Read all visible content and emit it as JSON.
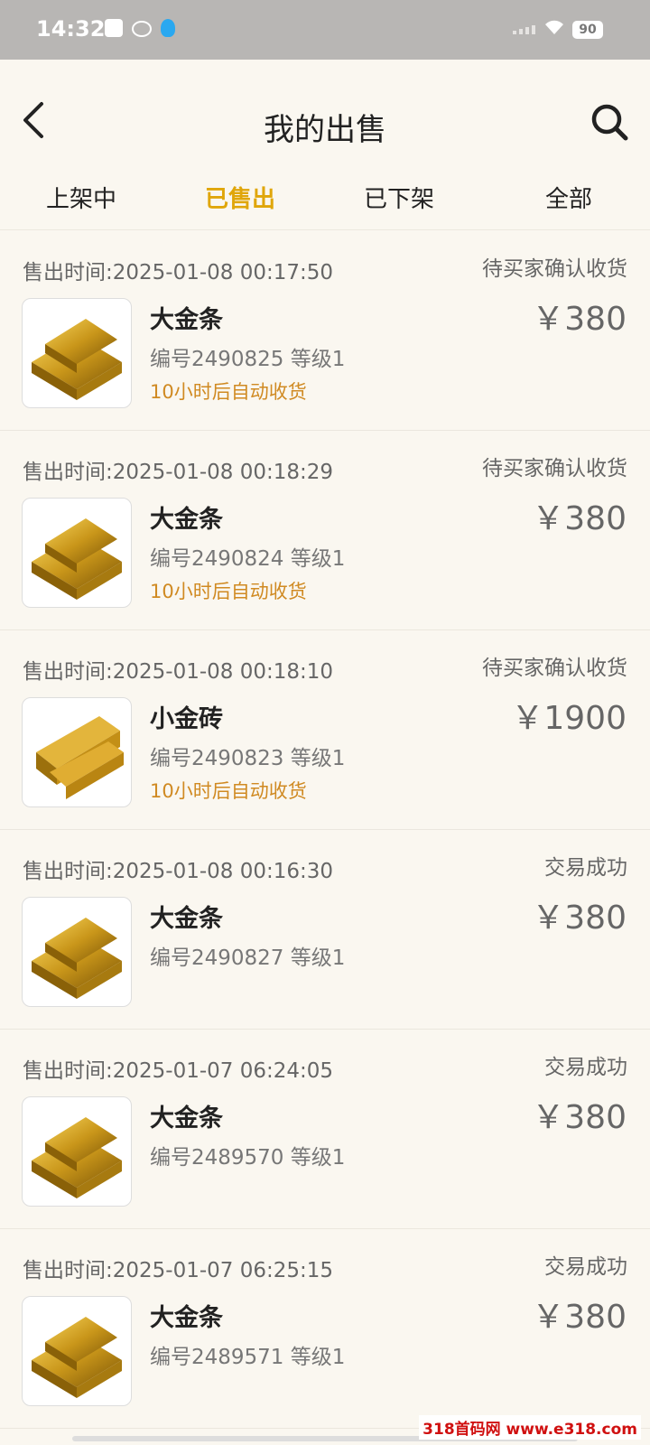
{
  "status_bar": {
    "time": "14:32",
    "battery": "90"
  },
  "header": {
    "title": "我的出售"
  },
  "tabs": [
    {
      "label": "上架中",
      "active": false
    },
    {
      "label": "已售出",
      "active": true
    },
    {
      "label": "已下架",
      "active": false
    },
    {
      "label": "全部",
      "active": false
    }
  ],
  "orders": [
    {
      "time": "售出时间:2025-01-08 00:17:50",
      "status": "待买家确认收货",
      "name": "大金条",
      "info": "编号2490825 等级1",
      "note": "10小时后自动收货",
      "price": "￥380",
      "item_type": "gold-bars-icon"
    },
    {
      "time": "售出时间:2025-01-08 00:18:29",
      "status": "待买家确认收货",
      "name": "大金条",
      "info": "编号2490824 等级1",
      "note": "10小时后自动收货",
      "price": "￥380",
      "item_type": "gold-bars-icon"
    },
    {
      "time": "售出时间:2025-01-08 00:18:10",
      "status": "待买家确认收货",
      "name": "小金砖",
      "info": "编号2490823 等级1",
      "note": "10小时后自动收货",
      "price": "￥1900",
      "item_type": "gold-bricks-icon"
    },
    {
      "time": "售出时间:2025-01-08 00:16:30",
      "status": "交易成功",
      "name": "大金条",
      "info": "编号2490827 等级1",
      "note": "",
      "price": "￥380",
      "item_type": "gold-bars-icon"
    },
    {
      "time": "售出时间:2025-01-07 06:24:05",
      "status": "交易成功",
      "name": "大金条",
      "info": "编号2489570 等级1",
      "note": "",
      "price": "￥380",
      "item_type": "gold-bars-icon"
    },
    {
      "time": "售出时间:2025-01-07 06:25:15",
      "status": "交易成功",
      "name": "大金条",
      "info": "编号2489571 等级1",
      "note": "",
      "price": "￥380",
      "item_type": "gold-bars-icon"
    }
  ],
  "watermark": "318首码网 www.e318.com",
  "colors": {
    "accent": "#e0a60a",
    "note": "#d08a22",
    "background": "#faf7f0"
  }
}
